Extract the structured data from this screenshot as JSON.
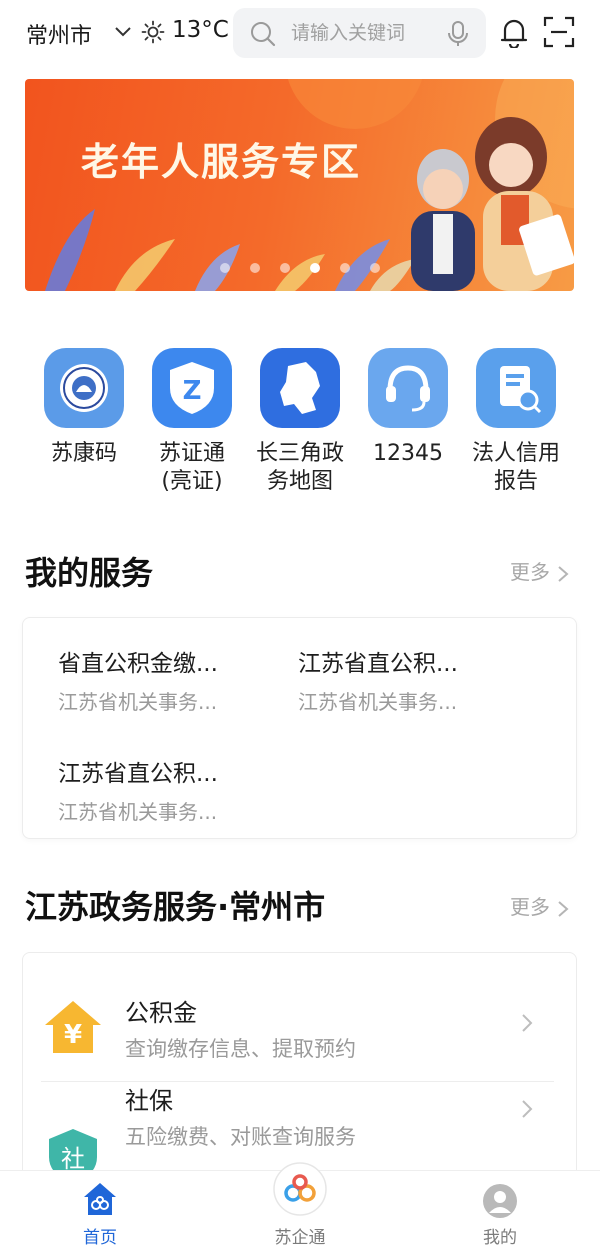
{
  "header": {
    "city": "常州市",
    "temperature": "13°C",
    "weather_icon": "sun-icon",
    "search_placeholder": "请输入关键词"
  },
  "banner": {
    "title": "老年人服务专区",
    "slide_count": 6,
    "active_slide": 3
  },
  "quick_services": [
    {
      "label": "苏康码",
      "icon": "sukang-code-icon",
      "color": "#5b9be8"
    },
    {
      "label": "苏证通\n(亮证)",
      "icon": "suzhengtong-icon",
      "color": "#3d88ee"
    },
    {
      "label": "长三角政\n务地图",
      "icon": "yangtze-map-icon",
      "color": "#2f6ee0"
    },
    {
      "label": "12345",
      "icon": "hotline-icon",
      "color": "#6aa7ee"
    },
    {
      "label": "法人信用\n报告",
      "icon": "credit-report-icon",
      "color": "#5aa0ec"
    }
  ],
  "my_services": {
    "title": "我的服务",
    "more_label": "更多",
    "items": [
      {
        "name": "省直公积金缴...",
        "sub": "江苏省机关事务..."
      },
      {
        "name": "江苏省直公积...",
        "sub": "江苏省机关事务..."
      },
      {
        "name": "江苏省直公积...",
        "sub": "江苏省机关事务..."
      }
    ]
  },
  "jiangsu_services": {
    "title": "江苏政务服务·常州市",
    "more_label": "更多",
    "items": [
      {
        "title": "公积金",
        "sub": "查询缴存信息、提取预约",
        "icon": "housing-fund-icon"
      },
      {
        "title": "社保",
        "sub": "五险缴费、对账查询服务",
        "icon": "social-security-icon"
      }
    ]
  },
  "bottom_nav": {
    "items": [
      {
        "label": "首页",
        "icon": "home-icon",
        "active": true
      },
      {
        "label": "苏企通",
        "icon": "suqitong-icon",
        "active": false
      },
      {
        "label": "我的",
        "icon": "profile-icon",
        "active": false
      }
    ]
  },
  "colors": {
    "accent": "#1f66d8",
    "banner": "#f2541e",
    "fund_yellow": "#f7b731",
    "social_teal": "#3fb6a8"
  }
}
